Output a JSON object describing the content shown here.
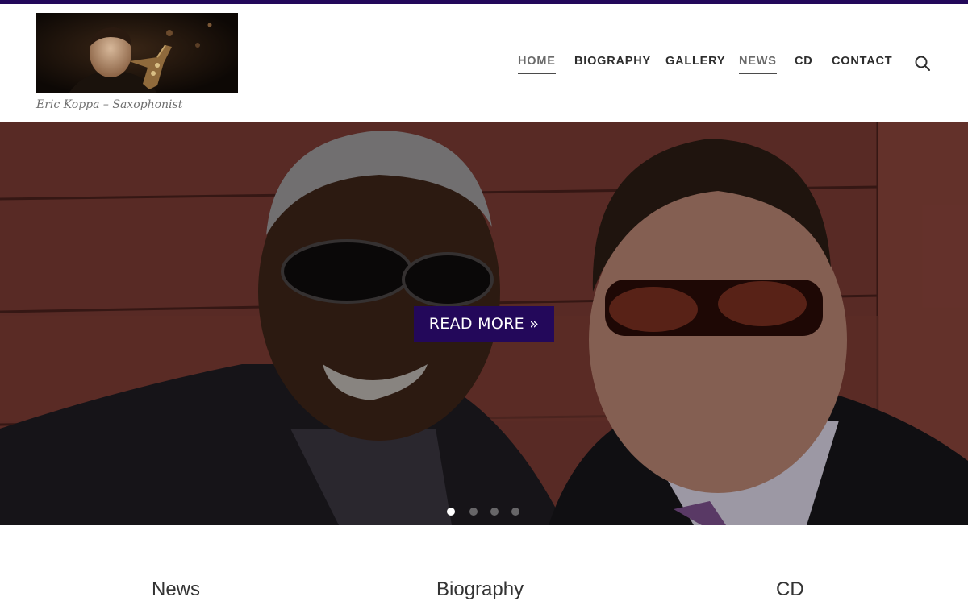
{
  "site": {
    "tagline": "Eric Koppa – Saxophonist"
  },
  "nav": {
    "items": [
      {
        "label": "HOME",
        "active": true
      },
      {
        "label": "BIOGRAPHY",
        "active": false
      },
      {
        "label": "GALLERY",
        "active": false
      },
      {
        "label": "NEWS",
        "active": true
      },
      {
        "label": "CD",
        "active": false
      },
      {
        "label": "CONTACT",
        "active": false
      }
    ],
    "search_icon": "search-icon"
  },
  "hero": {
    "cta_label": "READ MORE »",
    "slides_count": 4,
    "active_slide": 1
  },
  "features": {
    "items": [
      {
        "title": "News"
      },
      {
        "title": "Biography"
      },
      {
        "title": "CD"
      }
    ]
  },
  "colors": {
    "accent": "#23085a",
    "nav_text": "#2d2d2d",
    "tagline": "#6f6f6f"
  }
}
